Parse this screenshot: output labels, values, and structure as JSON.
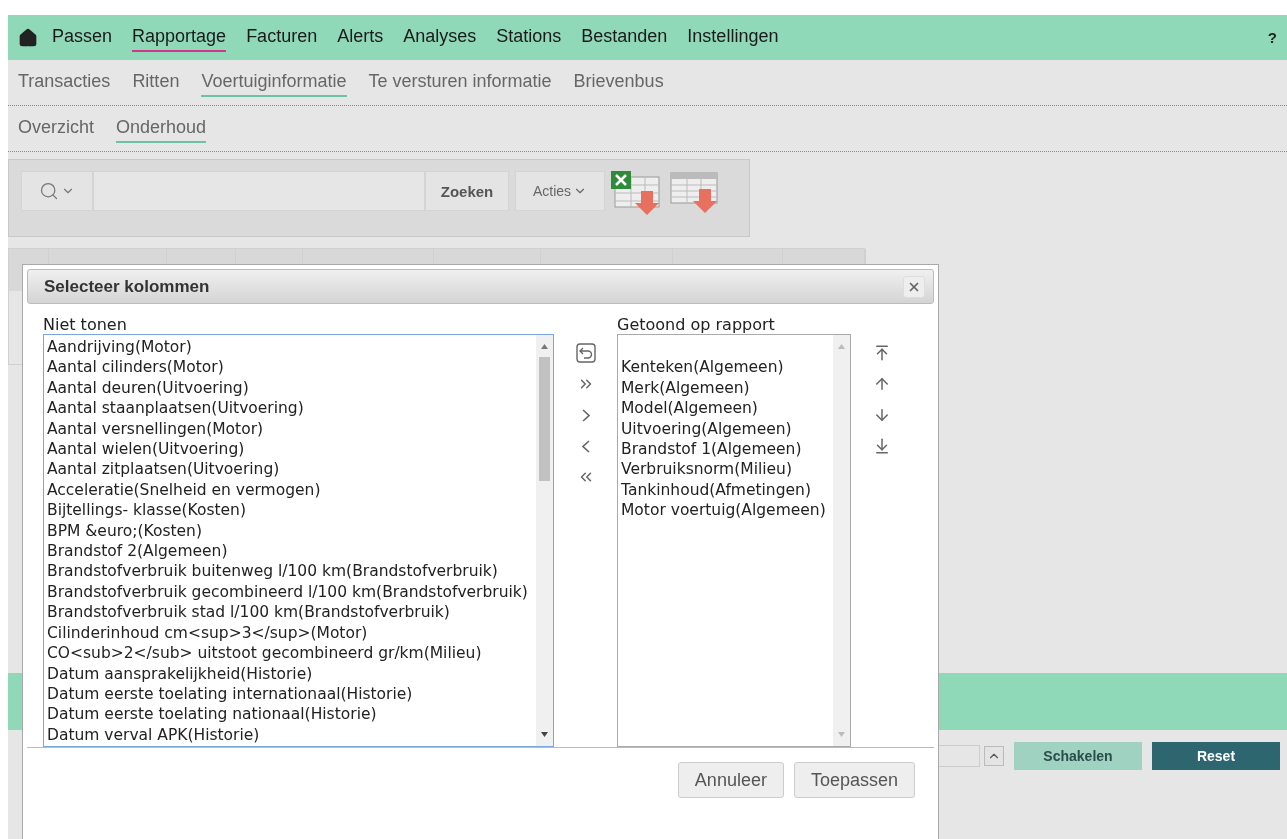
{
  "main_nav": {
    "items": [
      {
        "label": "Passen",
        "selected": false
      },
      {
        "label": "Rapportage",
        "selected": true
      },
      {
        "label": "Facturen",
        "selected": false
      },
      {
        "label": "Alerts",
        "selected": false
      },
      {
        "label": "Analyses",
        "selected": false
      },
      {
        "label": "Stations",
        "selected": false
      },
      {
        "label": "Bestanden",
        "selected": false
      },
      {
        "label": "Instellingen",
        "selected": false
      }
    ],
    "help": "?"
  },
  "sub_nav": {
    "items": [
      {
        "label": "Transacties",
        "selected": false
      },
      {
        "label": "Ritten",
        "selected": false
      },
      {
        "label": "Voertuiginformatie",
        "selected": true
      },
      {
        "label": "Te versturen informatie",
        "selected": false
      },
      {
        "label": "Brievenbus",
        "selected": false
      }
    ]
  },
  "tabs": [
    {
      "label": "Overzicht",
      "selected": false
    },
    {
      "label": "Onderhoud",
      "selected": true
    }
  ],
  "toolbar": {
    "search_button": "Zoeken",
    "actions": "Acties"
  },
  "footer": {
    "switch_button": "Schakelen",
    "reset_button": "Reset"
  },
  "dialog": {
    "title": "Selecteer kolommen",
    "hidden_label": "Niet tonen",
    "hidden_items": [
      "Aandrijving(Motor)",
      "Aantal cilinders(Motor)",
      "Aantal deuren(Uitvoering)",
      "Aantal staanplaatsen(Uitvoering)",
      "Aantal versnellingen(Motor)",
      "Aantal wielen(Uitvoering)",
      "Aantal zitplaatsen(Uitvoering)",
      "Acceleratie(Snelheid en vermogen)",
      "Bijtellings- klasse(Kosten)",
      "BPM &euro;(Kosten)",
      "Brandstof 2(Algemeen)",
      "Brandstofverbruik buitenweg l/100 km(Brandstofverbruik)",
      "Brandstofverbruik gecombineerd l/100 km(Brandstofverbruik)",
      "Brandstofverbruik stad l/100 km(Brandstofverbruik)",
      "Cilinderinhoud cm<sup>3</sup>(Motor)",
      "CO<sub>2</sub> uitstoot gecombineerd gr/km(Milieu)",
      "Datum aansprakelijkheid(Historie)",
      "Datum eerste toelating internationaal(Historie)",
      "Datum eerste toelating nationaal(Historie)",
      "Datum verval APK(Historie)"
    ],
    "shown_label": "Getoond op rapport",
    "shown_items": [
      "Kenteken(Algemeen)",
      "Merk(Algemeen)",
      "Model(Algemeen)",
      "Uitvoering(Algemeen)",
      "Brandstof 1(Algemeen)",
      "Verbruiksnorm(Milieu)",
      "Tankinhoud(Afmetingen)",
      "Motor voertuig(Algemeen)"
    ],
    "buttons": [
      "Annuleer",
      "Toepassen"
    ]
  }
}
